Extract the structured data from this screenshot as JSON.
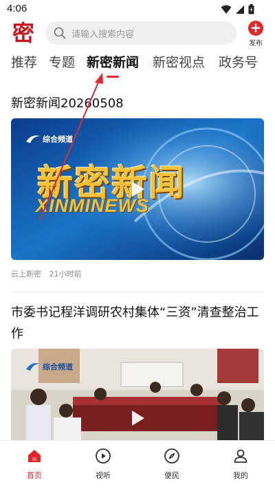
{
  "status": {
    "time": "4:06"
  },
  "header": {
    "logo_char": "密",
    "search_placeholder": "请输入搜索内容",
    "publish_label": "发布"
  },
  "tabs": [
    {
      "label": "推荐",
      "active": false
    },
    {
      "label": "专题",
      "active": false
    },
    {
      "label": "新密新闻",
      "active": true
    },
    {
      "label": "新密视点",
      "active": false
    },
    {
      "label": "政务号",
      "active": false
    }
  ],
  "feed": [
    {
      "title": "新密新闻20260508",
      "channel": "综合频道",
      "banner_text": "新密新闻",
      "banner_sub": "XINMINEWS",
      "source": "云上新密",
      "time": "21小时前"
    },
    {
      "title": "市委书记程洋调研农村集体“三资”清查整治工作",
      "channel": "综合频道"
    }
  ],
  "bottom_nav": [
    {
      "label": "首页",
      "icon": "home-icon",
      "active": true
    },
    {
      "label": "视听",
      "icon": "play-circle-icon",
      "active": false
    },
    {
      "label": "便民",
      "icon": "compass-icon",
      "active": false
    },
    {
      "label": "我的",
      "icon": "user-icon",
      "active": false
    }
  ],
  "colors": {
    "accent": "#e4262b",
    "logo": "#c4161c"
  }
}
